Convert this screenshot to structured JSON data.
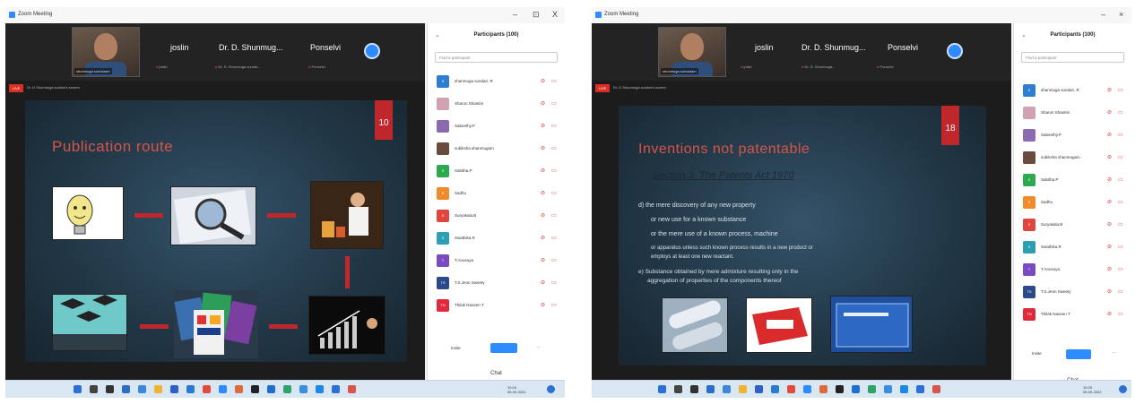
{
  "left": {
    "window_title": "Zoom Meeting",
    "controls": [
      "–",
      "⊡",
      "X"
    ],
    "self_caption": "shunmuga sundaram",
    "tiles": [
      {
        "name": "joslin",
        "sub": "joslin"
      },
      {
        "name": "Dr. D. Shunmug...",
        "sub": "Dr. D. Shunmuga sundar..."
      },
      {
        "name": "Ponselvi",
        "sub": "Ponselvi"
      }
    ],
    "share_badge": "LIVE",
    "view_label": "Dr. D Shunmuga sundar's screen",
    "slide": {
      "number": "10",
      "title": "Publication route"
    },
    "panel": {
      "title": "Participants (100)",
      "search_placeholder": "Find a participant",
      "participants": [
        {
          "initials": "S",
          "name": "shanmuga sundari. R",
          "color": "#2f7fd1"
        },
        {
          "initials": "",
          "name": "Sharon Shantini",
          "color": "#d0a2b4"
        },
        {
          "initials": "",
          "name": "Sabeethy.P",
          "color": "#8c6ab0"
        },
        {
          "initials": "",
          "name": "subiksha shanmugam",
          "color": "#6a4c3c"
        },
        {
          "initials": "S",
          "name": "Sabitha.P",
          "color": "#2eaa4e"
        },
        {
          "initials": "S",
          "name": "Sadhu",
          "color": "#f08a2b"
        },
        {
          "initials": "S",
          "name": "Suryakala.B",
          "color": "#e0453e"
        },
        {
          "initials": "S",
          "name": "Swathika.R",
          "color": "#2d9fb3"
        },
        {
          "initials": "T",
          "name": "T.Anusuya",
          "color": "#7b4bc2"
        },
        {
          "initials": "TS",
          "name": "T.S.Jeon Sweety",
          "color": "#2a4a8c"
        },
        {
          "initials": "TN",
          "name": "Thilak Naveen T",
          "color": "#e0293a"
        }
      ],
      "invite": "Invite",
      "mute_all": "Mute All",
      "more": "...",
      "chat": "Chat"
    },
    "tray_date": "05-09-2022",
    "tray_time": "10:16"
  },
  "right": {
    "window_title": "Zoom Meeting",
    "controls": [
      "–",
      "×"
    ],
    "self_caption": "shunmuga sundaram",
    "tiles": [
      {
        "name": "joslin",
        "sub": "joslin"
      },
      {
        "name": "Dr. D. Shunmug...",
        "sub": "Dr. D. Shunmuga..."
      },
      {
        "name": "Ponselvi",
        "sub": "Ponselvi"
      }
    ],
    "share_badge": "LIVE",
    "view_label": "Dr. D Shunmuga sundar's screen",
    "slide": {
      "number": "18",
      "title": "Inventions not patentable",
      "subhead": "Section 3, The Patents Act 1970",
      "bullets": [
        "d) the mere discovery of any new property",
        "or new use for a known substance",
        "or the mere use of a known process, machine",
        "or apparatus unless such known process results in a new product or",
        "employs at least one new reactant.",
        "e) Substance obtained by mere admixture resulting only in the",
        "aggregation of properties of the components thereof"
      ]
    },
    "panel": {
      "title": "Participants (100)",
      "search_placeholder": "Find a participant",
      "participants": [
        {
          "initials": "S",
          "name": "shanmuga sundari. R",
          "color": "#2f7fd1"
        },
        {
          "initials": "",
          "name": "Sharon Shantini",
          "color": "#d0a2b4"
        },
        {
          "initials": "",
          "name": "Sabeethy.P",
          "color": "#8c6ab0"
        },
        {
          "initials": "",
          "name": "subiksha shanmugam",
          "color": "#6a4c3c"
        },
        {
          "initials": "S",
          "name": "Sabitha.P",
          "color": "#2eaa4e"
        },
        {
          "initials": "S",
          "name": "Sadhu",
          "color": "#f08a2b"
        },
        {
          "initials": "S",
          "name": "Suryakala.B",
          "color": "#e0453e"
        },
        {
          "initials": "S",
          "name": "Swathika.R",
          "color": "#2d9fb3"
        },
        {
          "initials": "T",
          "name": "T.Anusuya",
          "color": "#7b4bc2"
        },
        {
          "initials": "TS",
          "name": "T.S.Jeon Sweety",
          "color": "#2a4a8c"
        },
        {
          "initials": "TN",
          "name": "Thilak Naveen T",
          "color": "#e0293a"
        }
      ],
      "invite": "Invite",
      "mute_all": "Mute All",
      "more": "...",
      "chat": "Chat"
    },
    "tray_date": "05-09-2022",
    "tray_time": "10:25"
  },
  "colors": {
    "zoom_blue": "#2d8cff",
    "accent_red": "#c0272d",
    "slide_bg": "#223847"
  }
}
